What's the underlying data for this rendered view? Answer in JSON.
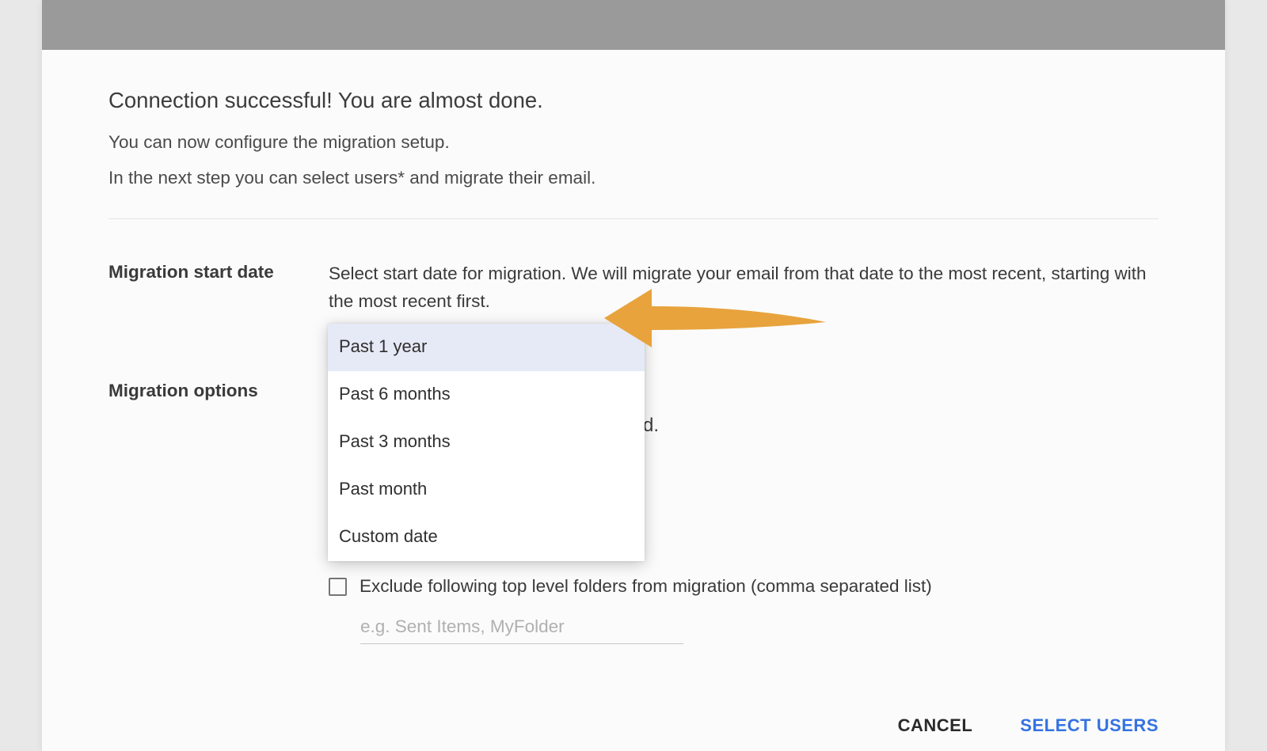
{
  "header": {
    "headline": "Connection successful! You are almost done.",
    "sub1": "You can now configure the migration setup.",
    "sub2": "In the next step you can select users* and migrate their email."
  },
  "startDate": {
    "label": "Migration start date",
    "description": "Select start date for migration. We will migrate your email from that date to the most recent, starting with the most recent first.",
    "options": [
      "Past 1 year",
      "Past 6 months",
      "Past 3 months",
      "Past month",
      "Custom date"
    ],
    "selected": "Past 1 year"
  },
  "options": {
    "label": "Migration options",
    "hidden_text": "d.",
    "exclude_label": "Exclude following top level folders from migration (comma separated list)",
    "exclude_placeholder": "e.g. Sent Items, MyFolder"
  },
  "footer": {
    "cancel": "CANCEL",
    "primary": "SELECT USERS"
  }
}
